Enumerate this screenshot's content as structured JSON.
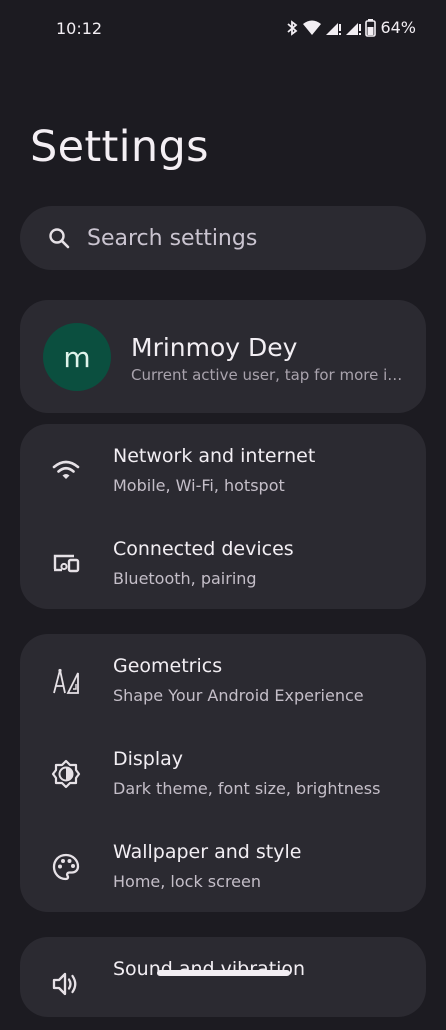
{
  "status_bar": {
    "time": "10:12",
    "battery": "64%"
  },
  "header": {
    "title": "Settings"
  },
  "search": {
    "placeholder": "Search settings"
  },
  "user": {
    "initial": "m",
    "name": "Mrinmoy Dey",
    "subtitle": "Current active user, tap for more inf..."
  },
  "groups": [
    {
      "items": [
        {
          "icon": "wifi-icon",
          "title": "Network and internet",
          "subtitle": "Mobile, Wi-Fi, hotspot"
        },
        {
          "icon": "connected-devices-icon",
          "title": "Connected devices",
          "subtitle": "Bluetooth, pairing"
        }
      ]
    },
    {
      "items": [
        {
          "icon": "geometry-tools-icon",
          "title": "Geometrics",
          "subtitle": "Shape Your Android Experience"
        },
        {
          "icon": "brightness-icon",
          "title": "Display",
          "subtitle": "Dark theme, font size, brightness"
        },
        {
          "icon": "palette-icon",
          "title": "Wallpaper and style",
          "subtitle": "Home, lock screen"
        }
      ]
    },
    {
      "items": [
        {
          "icon": "volume-icon",
          "title": "Sound and vibration"
        }
      ]
    }
  ],
  "colors": {
    "background": "#1c1b21",
    "card": "#2b2a31",
    "avatar": "#0b4f3f"
  }
}
